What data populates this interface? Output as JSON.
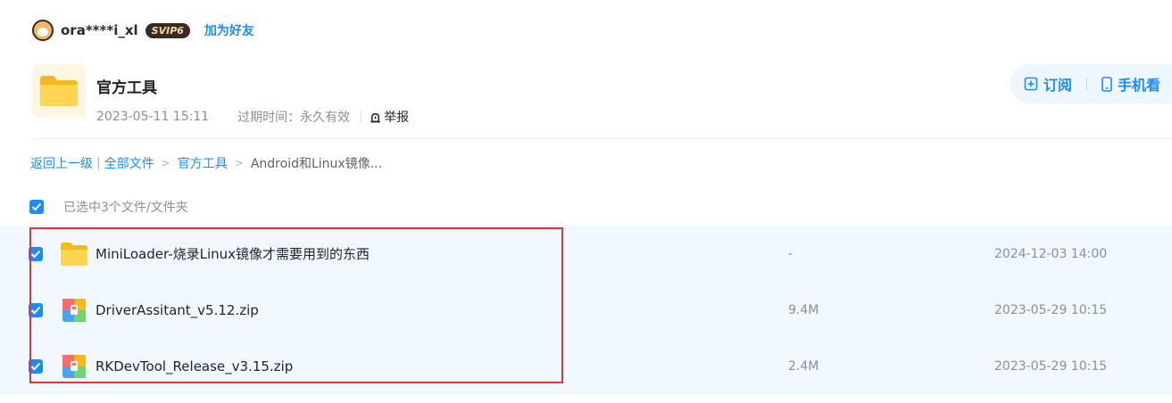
{
  "user": {
    "name": "ora****i_xl",
    "badge": "SVIP6",
    "add_friend": "加为好友"
  },
  "share": {
    "title": "官方工具",
    "date": "2023-05-11 15:11",
    "expire": "过期时间：永久有效",
    "report": "举报"
  },
  "actions": {
    "subscribe": "订阅",
    "mobile": "手机看"
  },
  "breadcrumb": {
    "back": "返回上一级",
    "all": "全部文件",
    "folder": "官方工具",
    "current": "Android和Linux镜像..."
  },
  "selection": {
    "text": "已选中3个文件/文件夹"
  },
  "files": [
    {
      "name": "MiniLoader-烧录Linux镜像才需要用到的东西",
      "size": "-",
      "time": "2024-12-03 14:00",
      "type": "folder"
    },
    {
      "name": "DriverAssitant_v5.12.zip",
      "size": "9.4M",
      "time": "2023-05-29 10:15",
      "type": "zip"
    },
    {
      "name": "RKDevTool_Release_v3.15.zip",
      "size": "2.4M",
      "time": "2023-05-29 10:15",
      "type": "zip"
    }
  ],
  "colors": {
    "accent": "#1a8cff",
    "selected_bg": "#f2f8ff",
    "highlight": "#e0353f"
  }
}
